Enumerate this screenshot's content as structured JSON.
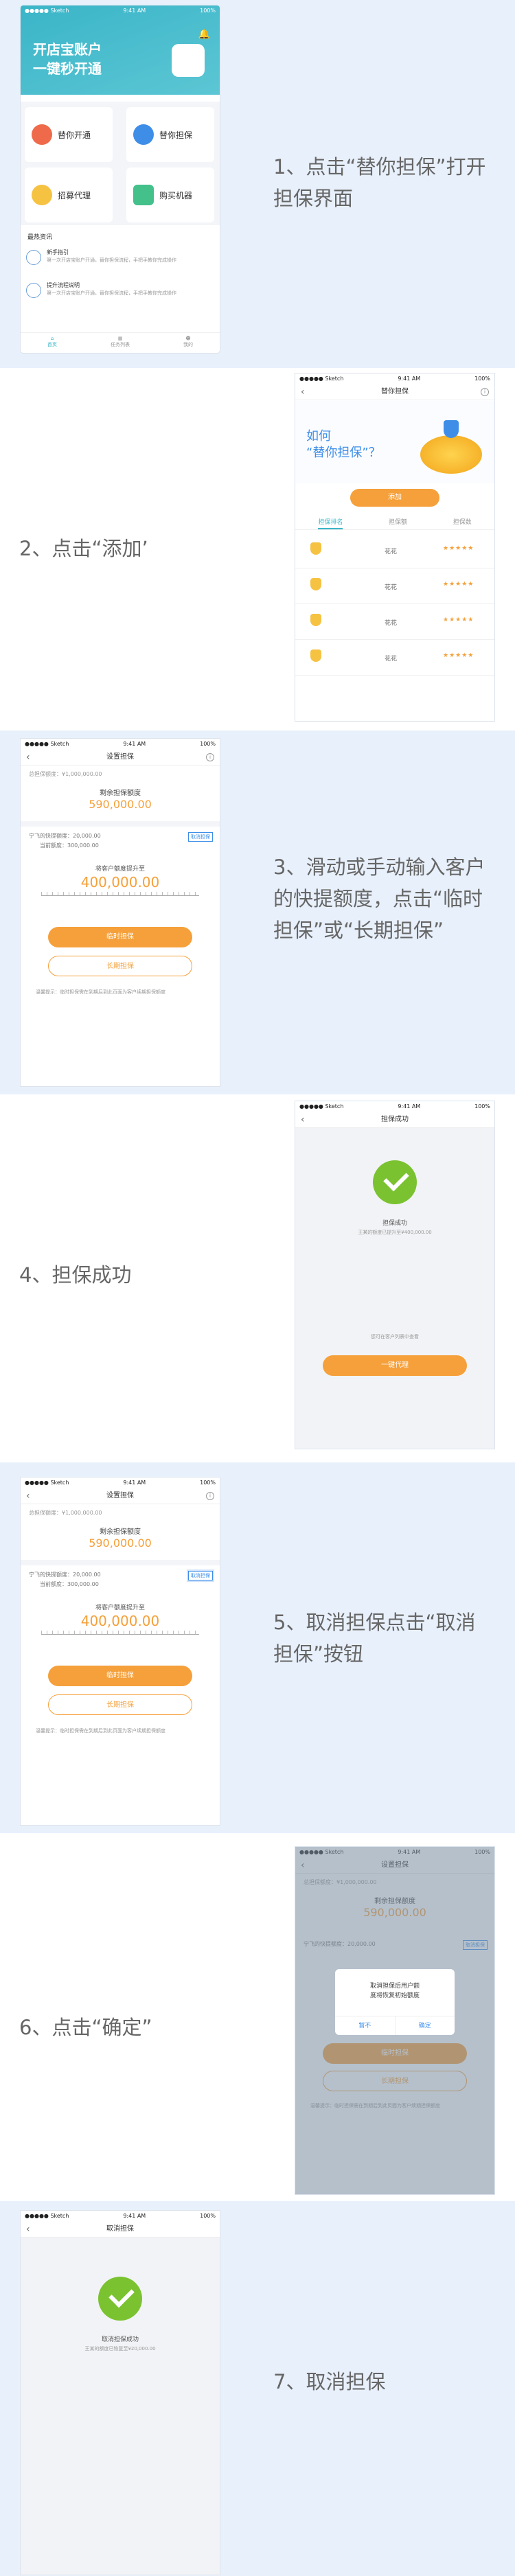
{
  "steps": [
    {
      "caption": "1、点击“替你担保”打开担保界面"
    },
    {
      "caption": "2、点击“添加’"
    },
    {
      "caption": "3、滑动或手动输入客户的快提额度，点击“临时担保”或“长期担保”"
    },
    {
      "caption": "4、担保成功"
    },
    {
      "caption": "5、取消担保点击“取消担保”按钮"
    },
    {
      "caption": "6、点击“确定”"
    },
    {
      "caption": "7、取消担保"
    }
  ],
  "status": {
    "carrier": "●●●●● Sketch",
    "time": "9:41 AM",
    "battery": "100%"
  },
  "s1": {
    "banner_line1": "开店宝账户",
    "banner_line2": "一键秒开通",
    "tiles": [
      "替你开通",
      "替你担保",
      "招募代理",
      "购买机器"
    ],
    "news_title": "最热资讯",
    "news": [
      {
        "title": "新手指引",
        "body": "第一次开店宝账户开通，替你担保流程，手把手教你完成操作"
      },
      {
        "title": "提升流程说明",
        "body": "第一次开店宝账户开通，替你担保流程，手把手教你完成操作"
      }
    ],
    "tabs": [
      "首页",
      "任务列表",
      "我的"
    ]
  },
  "s2": {
    "title": "替你担保",
    "hero_line1": "如何",
    "hero_line2": "“替你担保”？",
    "add": "添加",
    "cols": [
      "担保排名",
      "担保额",
      "担保数"
    ],
    "rows": [
      {
        "name": "花花",
        "stars": "★★★★★"
      },
      {
        "name": "花花",
        "stars": "★★★★★"
      },
      {
        "name": "花花",
        "stars": "★★★★★"
      },
      {
        "name": "花花",
        "stars": "★★★★★"
      }
    ]
  },
  "setup": {
    "title": "设置担保",
    "total": "总担保额度：¥1,000,000.00",
    "remain_label": "剩余担保额度",
    "remain_value": "590,000.00",
    "inline1": "宁飞的快提额度：20,000.00",
    "inline2": "当前额度：300,000.00",
    "cancel_btn": "取消担保",
    "dial_label": "将客户额度提升至",
    "dial_value": "400,000.00",
    "temp": "临时担保",
    "long": "长期担保",
    "note": "温馨提示：临时担保需在到期后到此页面为客户续期担保额度"
  },
  "s4": {
    "title": "担保成功",
    "msg": "担保成功",
    "sub": "王某的额度已提升至¥400,000.00",
    "hint": "您可在客户列表中查看",
    "btn": "一键代理"
  },
  "s6": {
    "dialog_line1": "取消担保后用户额",
    "dialog_line2": "度将恢复初始额度",
    "cancel": "暂不",
    "ok": "确定"
  },
  "s7": {
    "title": "取消担保",
    "msg": "取消担保成功",
    "sub": "王某的额度已恢复至¥20,000.00"
  },
  "colors": {
    "accent": "#f5a03a",
    "green": "#7ac230",
    "teal": "#3ab5c8",
    "bg": "#e8f0fb"
  }
}
